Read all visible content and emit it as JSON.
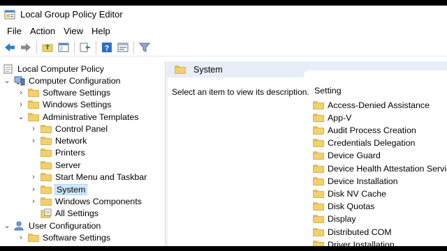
{
  "window": {
    "title": "Local Group Policy Editor"
  },
  "menu": [
    "File",
    "Action",
    "View",
    "Help"
  ],
  "tree": {
    "root": "Local Computer Policy",
    "computer_config": "Computer Configuration",
    "software_settings": "Software Settings",
    "windows_settings": "Windows Settings",
    "admin_templates": "Administrative Templates",
    "control_panel": "Control Panel",
    "network": "Network",
    "printers": "Printers",
    "server": "Server",
    "start_menu": "Start Menu and Taskbar",
    "system": "System",
    "windows_components": "Windows Components",
    "all_settings": "All Settings",
    "user_config": "User Configuration",
    "user_software_settings": "Software Settings"
  },
  "right_pane": {
    "header": "System",
    "description": "Select an item to view its description.",
    "column": "Setting",
    "settings": [
      "Access-Denied Assistance",
      "App-V",
      "Audit Process Creation",
      "Credentials Delegation",
      "Device Guard",
      "Device Health Attestation Service",
      "Device Installation",
      "Disk NV Cache",
      "Disk Quotas",
      "Display",
      "Distributed COM",
      "Driver Installation"
    ]
  },
  "icons": [
    "app-icon",
    "back-arrow-icon",
    "forward-arrow-icon",
    "up-folder-icon",
    "show-hide-tree-icon",
    "export-list-icon",
    "help-icon",
    "properties-icon",
    "filter-icon",
    "folder-icon",
    "computer-icon",
    "user-icon",
    "cursor-icon"
  ]
}
